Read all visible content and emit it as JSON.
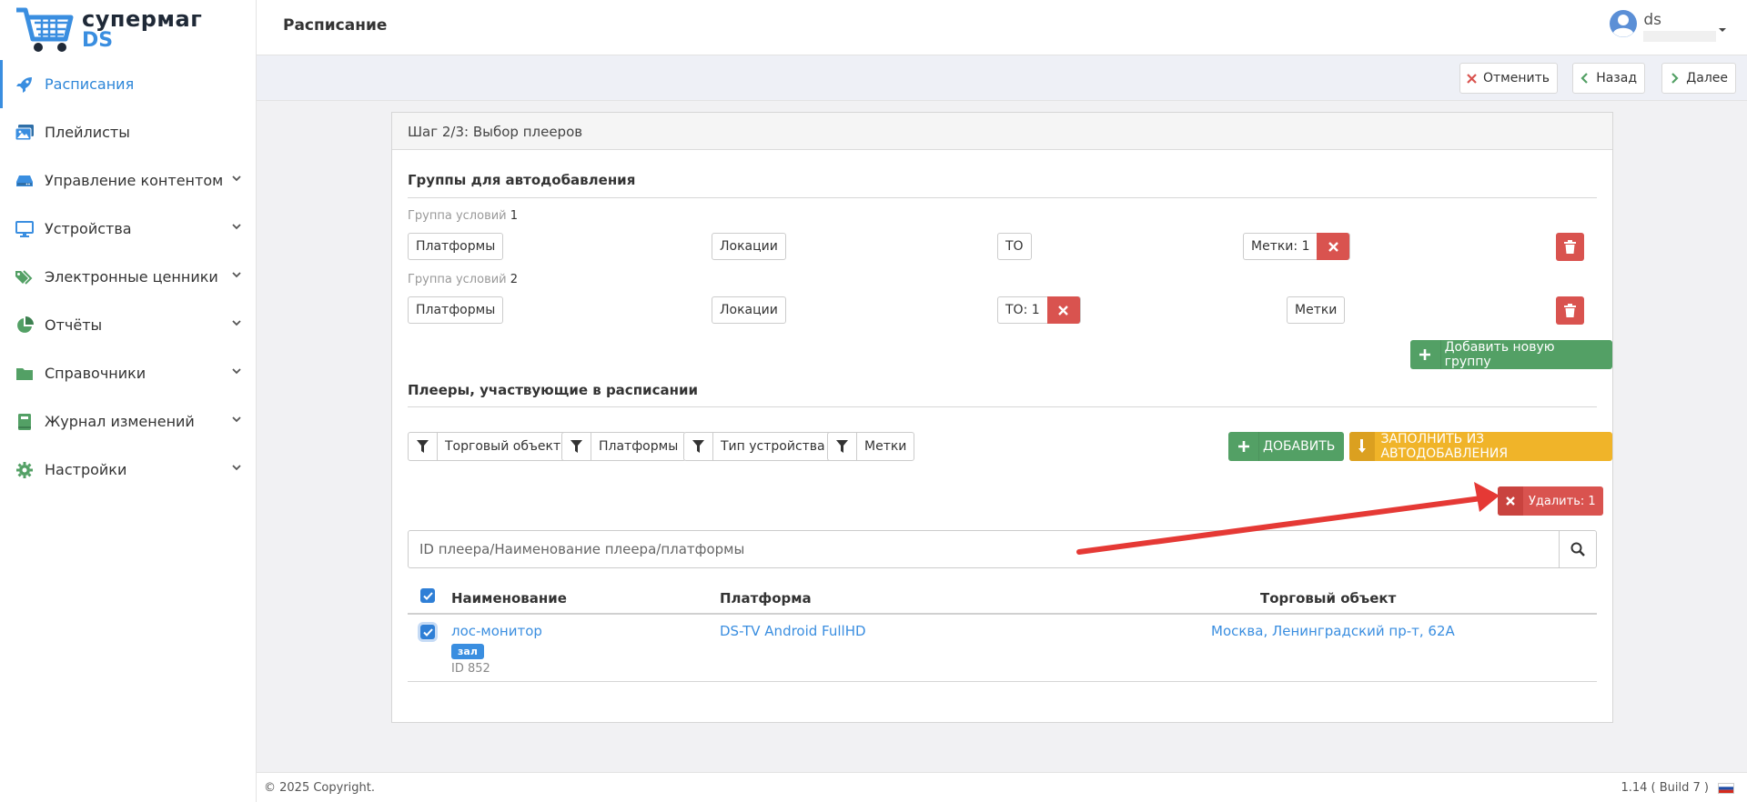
{
  "app": {
    "logo_line1": "супермаг",
    "logo_line2": "DS"
  },
  "sidebar": {
    "items": [
      {
        "label": "Расписания",
        "icon": "rocket-icon",
        "active": true
      },
      {
        "label": "Плейлисты",
        "icon": "images-icon"
      },
      {
        "label": "Управление контентом",
        "icon": "hdd-icon"
      },
      {
        "label": "Устройства",
        "icon": "monitor-icon"
      },
      {
        "label": "Электронные ценники",
        "icon": "tags-icon"
      },
      {
        "label": "Отчёты",
        "icon": "pie-chart-icon"
      },
      {
        "label": "Справочники",
        "icon": "folder-icon"
      },
      {
        "label": "Журнал изменений",
        "icon": "book-icon"
      },
      {
        "label": "Настройки",
        "icon": "gear-icon"
      }
    ]
  },
  "header": {
    "title": "Расписание",
    "user_name": "ds"
  },
  "actions": {
    "cancel": "Отменить",
    "back": "Назад",
    "next": "Далее"
  },
  "wizard": {
    "step_title": "Шаг 2/3: Выбор плееров",
    "autoadd_title": "Группы для автодобавления",
    "groups": [
      {
        "label": "Группа условий",
        "number": "1",
        "platforms": "Платформы",
        "locations": "Локации",
        "to": "ТО",
        "tags": "Метки: 1"
      },
      {
        "label": "Группа условий",
        "number": "2",
        "platforms": "Платформы",
        "locations": "Локации",
        "to": "ТО: 1",
        "tags": "Метки"
      }
    ],
    "add_group": "Добавить новую группу",
    "players_title": "Плееры, участвующие в расписании",
    "filters": [
      "Торговый объект",
      "Платформы",
      "Тип устройства",
      "Метки"
    ],
    "add_button": "ДОБАВИТЬ",
    "fill_button": "ЗАПОЛНИТЬ ИЗ АВТОДОБАВЛЕНИЯ",
    "delete_button": "Удалить: 1",
    "search_placeholder": "ID плеера/Наименование плеера/платформы"
  },
  "table": {
    "headers": [
      "Наименование",
      "Платформа",
      "Торговый объект"
    ],
    "rows": [
      {
        "name": "лос-монитор",
        "badge": "зал",
        "id": "ID 852",
        "platform": "DS-TV Android FullHD",
        "store": "Москва, Ленинградский пр-т, 62A",
        "checked": true
      }
    ]
  },
  "footer": {
    "copyright": "© 2025 Copyright.",
    "version": "1.14 ( Build 7 )"
  },
  "colors": {
    "accent": "#3a8ee0",
    "danger": "#d9534f",
    "success": "#53a065",
    "warning": "#f0b429",
    "annotation": "#e53935"
  }
}
